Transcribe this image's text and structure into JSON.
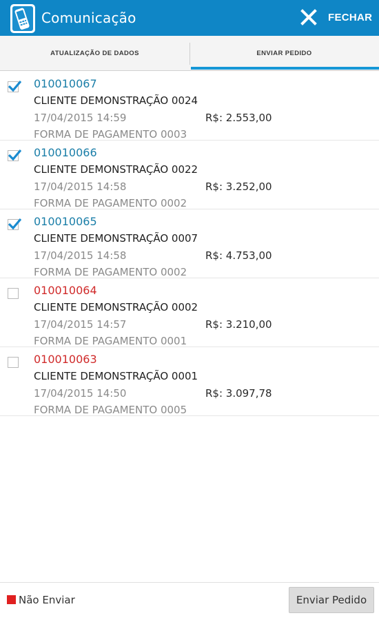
{
  "appbar": {
    "title": "Comunicação",
    "close_label": "FECHAR",
    "app_icon": "handheld-device-icon",
    "close_icon": "close-x-icon"
  },
  "tabs": [
    {
      "label": "ATUALIZAÇÃO DE DADOS",
      "selected": false
    },
    {
      "label": "ENVIAR PEDIDO",
      "selected": true
    }
  ],
  "orders": [
    {
      "code": "010010067",
      "checked": true,
      "client": "CLIENTE DEMONSTRAÇÃO 0024",
      "datetime": "17/04/2015 14:59",
      "amount": "R$: 2.553,00",
      "payment": "FORMA DE PAGAMENTO 0003"
    },
    {
      "code": "010010066",
      "checked": true,
      "client": "CLIENTE DEMONSTRAÇÃO 0022",
      "datetime": "17/04/2015 14:58",
      "amount": "R$: 3.252,00",
      "payment": "FORMA DE PAGAMENTO 0002"
    },
    {
      "code": "010010065",
      "checked": true,
      "client": "CLIENTE DEMONSTRAÇÃO 0007",
      "datetime": "17/04/2015 14:58",
      "amount": "R$: 4.753,00",
      "payment": "FORMA DE PAGAMENTO 0002"
    },
    {
      "code": "010010064",
      "checked": false,
      "client": "CLIENTE DEMONSTRAÇÃO 0002",
      "datetime": "17/04/2015 14:57",
      "amount": "R$: 3.210,00",
      "payment": "FORMA DE PAGAMENTO 0001"
    },
    {
      "code": "010010063",
      "checked": false,
      "client": "CLIENTE DEMONSTRAÇÃO 0001",
      "datetime": "17/04/2015 14:50",
      "amount": "R$: 3.097,78",
      "payment": "FORMA DE PAGAMENTO 0005"
    }
  ],
  "footer": {
    "legend_label": "Não Enviar",
    "send_button": "Enviar Pedido"
  },
  "colors": {
    "primary": "#0f86c6",
    "code_checked": "#1a7ea8",
    "code_unchecked": "#d02a2a",
    "check_mark": "#1a8bd0",
    "not_send": "#e02020"
  }
}
